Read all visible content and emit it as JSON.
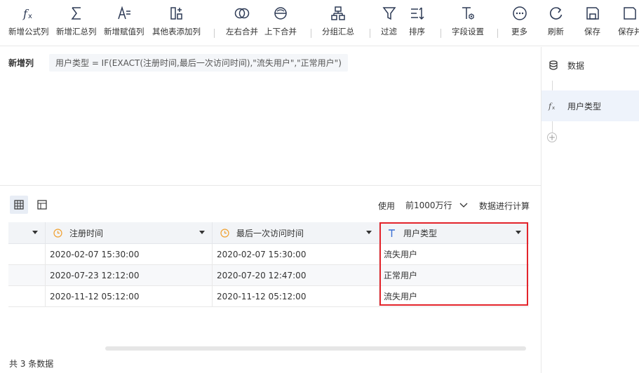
{
  "toolbar": {
    "items": [
      {
        "label": "新增公式列",
        "icon": "fx-icon"
      },
      {
        "label": "新增汇总列",
        "icon": "sigma-icon"
      },
      {
        "label": "新增赋值列",
        "icon": "assign-icon"
      },
      {
        "label": "其他表添加列",
        "icon": "add-column-icon"
      },
      {
        "label": "左右合并",
        "icon": "merge-horizontal-icon"
      },
      {
        "label": "上下合并",
        "icon": "merge-vertical-icon"
      },
      {
        "label": "分组汇总",
        "icon": "group-icon"
      },
      {
        "label": "过滤",
        "icon": "filter-icon"
      },
      {
        "label": "排序",
        "icon": "sort-icon"
      },
      {
        "label": "字段设置",
        "icon": "field-settings-icon"
      },
      {
        "label": "更多",
        "icon": "more-icon"
      },
      {
        "label": "刷新",
        "icon": "refresh-icon"
      },
      {
        "label": "保存",
        "icon": "save-icon"
      },
      {
        "label": "保存并",
        "icon": "save-as-icon"
      }
    ]
  },
  "formula": {
    "title": "新增列",
    "expression": "用户类型 = IF(EXACT(注册时间,最后一次访问时间),\"流失用户\",\"正常用户\")"
  },
  "right_panel": {
    "items": [
      {
        "label": "数据",
        "icon": "database-icon",
        "active": false
      },
      {
        "label": "用户类型",
        "icon": "fx-icon",
        "active": true
      }
    ],
    "add_icon": "plus-circle-icon",
    "add_glyph": "+"
  },
  "controls": {
    "use_label": "使用",
    "row_limit": "前1000万行",
    "compute_label": "数据进行计算"
  },
  "table": {
    "columns": [
      {
        "label": "",
        "type": ""
      },
      {
        "label": "注册时间",
        "type": "date"
      },
      {
        "label": "最后一次访问时间",
        "type": "date"
      },
      {
        "label": "用户类型",
        "type": "text"
      }
    ],
    "rows": [
      [
        "",
        "2020-02-07 15:30:00",
        "2020-02-07 15:30:00",
        "流失用户"
      ],
      [
        "",
        "2020-07-23 12:12:00",
        "2020-07-20 12:47:00",
        "正常用户"
      ],
      [
        "",
        "2020-11-12 05:12:00",
        "2020-11-12 05:12:00",
        "流失用户"
      ]
    ],
    "highlight_column": "用户类型",
    "highlight_color": "#e3242b"
  },
  "footer": {
    "count_text": "共 3 条数据"
  },
  "colors": {
    "accent": "#3b6fd4",
    "date_icon": "#f0a030",
    "text": "#333333"
  }
}
